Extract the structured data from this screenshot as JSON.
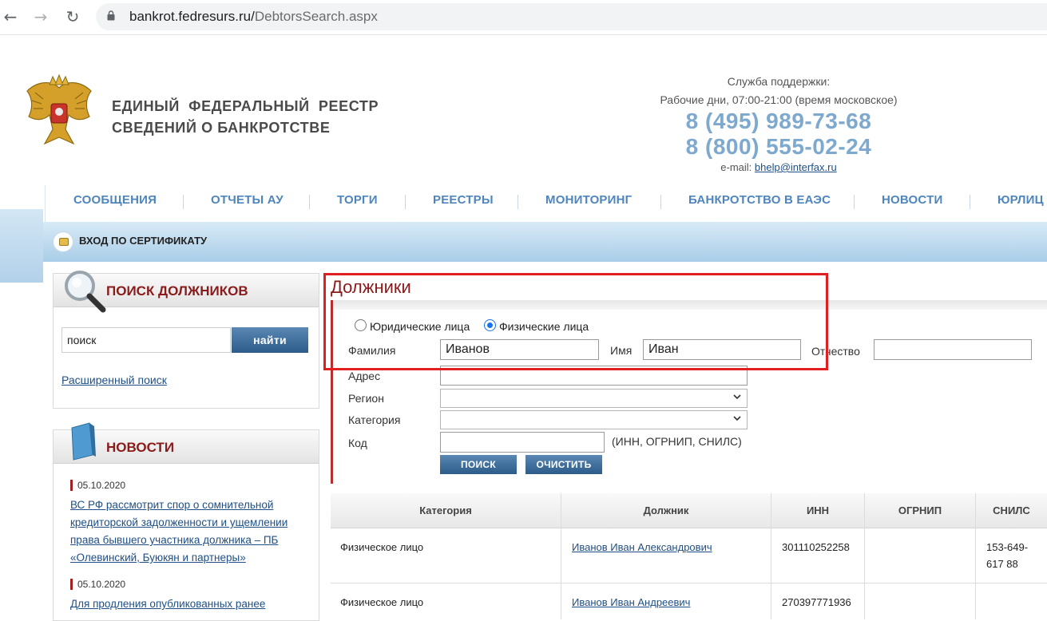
{
  "browser": {
    "url_domain": "bankrot.fedresurs.ru/",
    "url_path": "DebtorsSearch.aspx"
  },
  "header": {
    "title_line1": "ЕДИНЫЙ  ФЕДЕРАЛЬНЫЙ  РЕЕСТР",
    "title_line2": "СВЕДЕНИЙ О БАНКРОТСТВЕ",
    "support_title": "Служба поддержки:",
    "support_hours": "Рабочие дни, 07:00-21:00 (время московское)",
    "phone1": "8 (495) 989-73-68",
    "phone2": "8 (800) 555-02-24",
    "email_label": "e-mail: ",
    "email": "bhelp@interfax.ru"
  },
  "menu": {
    "items": [
      "СООБЩЕНИЯ",
      "ОТЧЕТЫ АУ",
      "ТОРГИ",
      "РЕЕСТРЫ",
      "МОНИТОРИНГ",
      "БАНКРОТСТВО В ЕАЭС",
      "НОВОСТИ",
      "ЮРЛИЦ"
    ]
  },
  "cert_login": "ВХОД ПО СЕРТИФИКАТУ",
  "sidebar": {
    "search_title": "ПОИСК ДОЛЖНИКОВ",
    "search_value": "поиск",
    "find_button": "найти",
    "advanced_link": "Расширенный поиск",
    "news_title": "НОВОСТИ",
    "news": [
      {
        "date": "05.10.2020",
        "text": "ВС РФ рассмотрит спор о сомнительной кредиторской задолженности и ущемлении права бывшего участника должника – ПБ «Олевинский, Буюкян и партнеры»"
      },
      {
        "date": "05.10.2020",
        "text": "Для продления опубликованных ранее"
      }
    ]
  },
  "form": {
    "title": "Должники",
    "radio_legal": "Юридические лица",
    "radio_person": "Физические лица",
    "selected": "person",
    "surname_label": "Фамилия",
    "surname_value": "Иванов",
    "name_label": "Имя",
    "name_value": "Иван",
    "patronymic_label": "Отчество",
    "patronymic_value": "",
    "address_label": "Адрес",
    "region_label": "Регион",
    "category_label": "Категория",
    "code_label": "Код",
    "code_hint": "(ИНН, ОГРНИП, СНИЛС)",
    "search_button": "ПОИСК",
    "clear_button": "ОЧИСТИТЬ"
  },
  "results": {
    "columns": [
      "Категория",
      "Должник",
      "ИНН",
      "ОГРНИП",
      "СНИЛС"
    ],
    "rows": [
      {
        "category": "Физическое лицо",
        "debtor": "Иванов Иван Александрович",
        "inn": "301110252258",
        "ogrnip": "",
        "snils_1": "153-649-",
        "snils_2": "617 88"
      },
      {
        "category": "Физическое лицо",
        "debtor": "Иванов Иван Андреевич",
        "inn": "270397771936",
        "ogrnip": "",
        "snils_1": "",
        "snils_2": ""
      }
    ]
  },
  "colors": {
    "accent_blue": "#4e85bd",
    "title_red": "#8b1a1a",
    "phone_blue": "#7ea9cf",
    "highlight_red": "#e02020"
  }
}
